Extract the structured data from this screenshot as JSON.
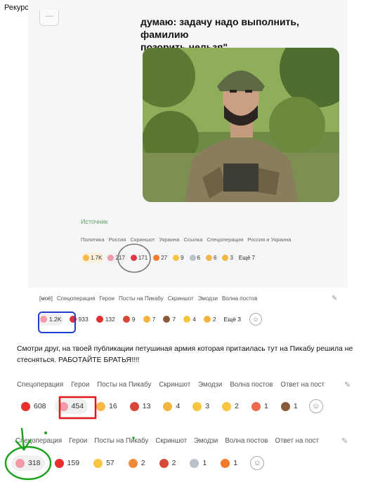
{
  "caption": "Рекурсия пошла)))",
  "post2": {
    "quote_line1": "думаю: задачу надо выполнить, фамилию",
    "quote_line2": "позорить нельзя\"",
    "source": "Источник",
    "tags": [
      "Политика",
      "Россия",
      "Скриншот",
      "Украина",
      "Ссылка",
      "Спецоперация",
      "Россия и Украина"
    ],
    "reactions": [
      {
        "emoji": "clap-icon",
        "count": "1.7K",
        "color": "#f6b94a"
      },
      {
        "emoji": "pig-icon",
        "count": "217",
        "color": "#f29aa8"
      },
      {
        "emoji": "heart-icon",
        "count": "171",
        "color": "#e2364b"
      },
      {
        "emoji": "fire-icon",
        "count": "27",
        "color": "#f27a2a"
      },
      {
        "emoji": "laugh-icon",
        "count": "9",
        "color": "#f7c53f"
      },
      {
        "emoji": "dove-icon",
        "count": "6",
        "color": "#b9c2cc"
      },
      {
        "emoji": "facepalm-icon",
        "count": "6",
        "color": "#f4b64c"
      },
      {
        "emoji": "pray-icon",
        "count": "3",
        "color": "#f5b845"
      }
    ],
    "more_label": "Ещё 7"
  },
  "post3": {
    "tags_first": "[моё]",
    "tags": [
      "Спецоперация",
      "Герои",
      "Посты на Пикабу",
      "Скриншот",
      "Эмодзи",
      "Волна постов"
    ],
    "reactions": [
      {
        "emoji": "pig-icon",
        "count": "1.2K",
        "color": "#f29aa8"
      },
      {
        "emoji": "hundred-icon",
        "count": "933",
        "color": "#e5302f"
      },
      {
        "emoji": "hundred-icon",
        "count": "132",
        "color": "#e5302f"
      },
      {
        "emoji": "rooster-icon",
        "count": "9",
        "color": "#d9473a"
      },
      {
        "emoji": "think-icon",
        "count": "7",
        "color": "#f3b540"
      },
      {
        "emoji": "poo-icon",
        "count": "7",
        "color": "#8a5a3b"
      },
      {
        "emoji": "laugh-icon",
        "count": "4",
        "color": "#f7c53f"
      },
      {
        "emoji": "ok-hand-icon",
        "count": "2",
        "color": "#f3b540"
      }
    ],
    "more_label": "Ещё 3"
  },
  "comment": {
    "text": "Смотри друг, на твоей публикации петушиная армия которая притаилась тут на Пикабу решила не стесняться. РАБОТАЙТЕ БРАТЬЯ!!!!"
  },
  "post1": {
    "tags": [
      "Спецоперация",
      "Герои",
      "Посты на Пикабу",
      "Скриншот",
      "Эмодзи",
      "Волна постов",
      "Ответ на пост"
    ],
    "reactions": [
      {
        "emoji": "hundred-icon",
        "count": "608",
        "color": "#e5302f"
      },
      {
        "emoji": "pig-icon",
        "count": "454",
        "color": "#f29aa8"
      },
      {
        "emoji": "clap-icon",
        "count": "16",
        "color": "#f6b94a"
      },
      {
        "emoji": "rooster-icon",
        "count": "13",
        "color": "#d9473a"
      },
      {
        "emoji": "kiss-icon",
        "count": "4",
        "color": "#f3b540"
      },
      {
        "emoji": "laugh-icon",
        "count": "3",
        "color": "#f7c53f"
      },
      {
        "emoji": "grin-icon",
        "count": "2",
        "color": "#f7c53f"
      },
      {
        "emoji": "party-icon",
        "count": "1",
        "color": "#ef6a4c"
      },
      {
        "emoji": "poo-icon",
        "count": "1",
        "color": "#8a5a3b"
      }
    ]
  },
  "post0": {
    "tags": [
      "Спецоперация",
      "Герои",
      "Посты на Пикабу",
      "Скриншот",
      "Эмодзи",
      "Волна постов",
      "Ответ на пост"
    ],
    "reactions": [
      {
        "emoji": "pig-icon",
        "count": "318",
        "color": "#f29aa8"
      },
      {
        "emoji": "hundred-icon",
        "count": "159",
        "color": "#e5302f"
      },
      {
        "emoji": "laugh-icon",
        "count": "57",
        "color": "#f7c53f"
      },
      {
        "emoji": "angry-icon",
        "count": "2",
        "color": "#f08a3a"
      },
      {
        "emoji": "rooster-icon",
        "count": "2",
        "color": "#d9473a"
      },
      {
        "emoji": "dove-icon",
        "count": "1",
        "color": "#b9c2cc"
      },
      {
        "emoji": "fire-icon",
        "count": "1",
        "color": "#f27a2a"
      }
    ]
  },
  "colors": {
    "highlight_gray": "#7a7a7a",
    "highlight_blue": "#1f3fcf",
    "highlight_red": "#e0141b",
    "annotation_green": "#1aa31a",
    "source_green": "#6aa36b"
  }
}
